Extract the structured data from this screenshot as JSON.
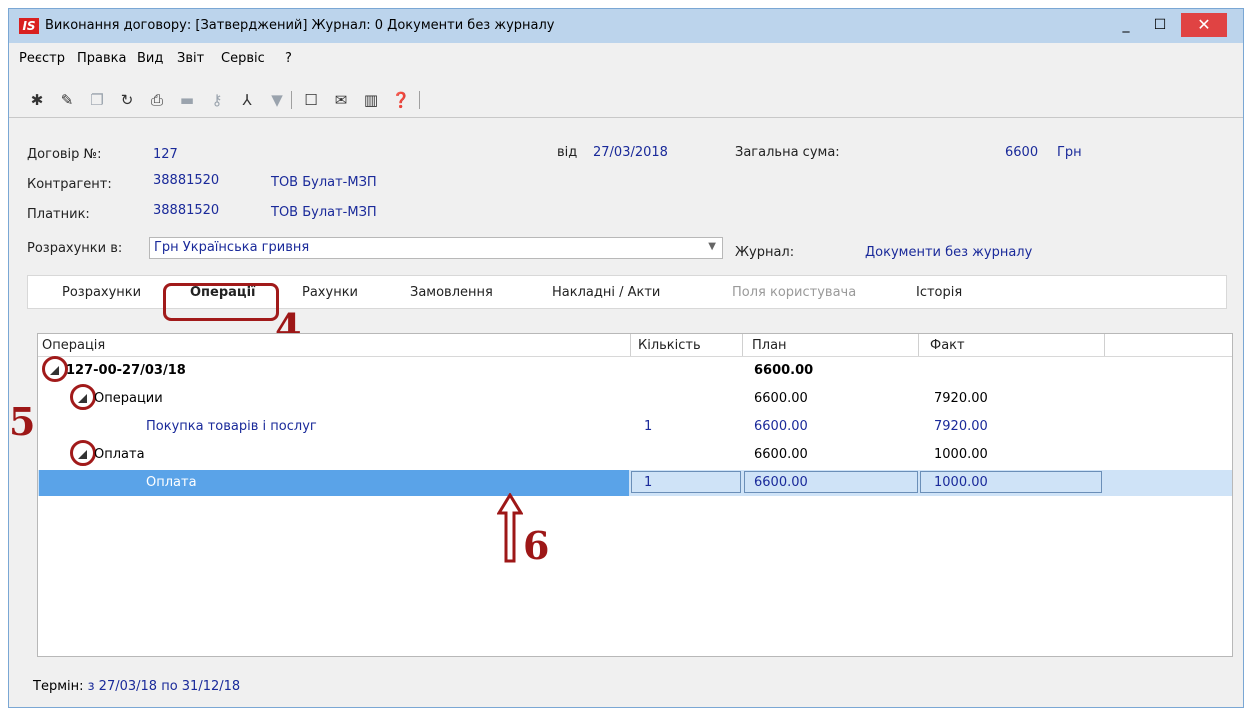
{
  "window": {
    "title": "Виконання договору: [Затверджений] Журнал: 0 Документи без журналу",
    "logo_text": "IS",
    "controls": {
      "minimize": "_",
      "maximize": "☐",
      "close": "✕"
    }
  },
  "menu": [
    "Реєстр",
    "Правка",
    "Вид",
    "Звіт",
    "Сервіс",
    "?"
  ],
  "toolbar": {
    "icons": [
      {
        "name": "new-doc-icon",
        "glyph": "✱",
        "dim": false
      },
      {
        "name": "edit-doc-icon",
        "glyph": "✎",
        "dim": false
      },
      {
        "name": "copy-doc-icon",
        "glyph": "❐",
        "dim": true
      },
      {
        "name": "refresh-icon",
        "glyph": "↻",
        "dim": false
      },
      {
        "name": "print-icon",
        "glyph": "⎙",
        "dim": false
      },
      {
        "name": "folder-icon",
        "glyph": "▬",
        "dim": true
      },
      {
        "name": "key-icon",
        "glyph": "⚷",
        "dim": true
      },
      {
        "name": "tree-icon",
        "glyph": "⅄",
        "dim": false
      },
      {
        "name": "filter-icon",
        "glyph": "▼",
        "dim": true
      },
      {
        "name": "window-icon",
        "glyph": "☐",
        "dim": false
      },
      {
        "name": "mail-icon",
        "glyph": "✉",
        "dim": false
      },
      {
        "name": "columns-icon",
        "glyph": "▥",
        "dim": false
      },
      {
        "name": "help-icon",
        "glyph": "❓",
        "dim": false
      }
    ]
  },
  "header": {
    "contract_label": "Договір  №:",
    "contract_no": "127",
    "date_label": "від",
    "date": "27/03/2018",
    "total_label": "Загальна сума:",
    "total_value": "6600",
    "total_currency": "Грн",
    "counterparty_label": "Контрагент:",
    "counterparty_code": "38881520",
    "counterparty_name": "ТОВ Булат-МЗП",
    "payer_label": "Платник:",
    "payer_code": "38881520",
    "payer_name": "ТОВ Булат-МЗП",
    "settlement_label": "Розрахунки в:",
    "settlement_value": "Грн Українська гривня",
    "journal_label": "Журнал:",
    "journal_value": "Документи без журналу"
  },
  "tabs": [
    {
      "label": "Розрахунки",
      "active": false,
      "disabled": false
    },
    {
      "label": "Операції",
      "active": true,
      "disabled": false
    },
    {
      "label": "Рахунки",
      "active": false,
      "disabled": false
    },
    {
      "label": "Замовлення",
      "active": false,
      "disabled": false
    },
    {
      "label": "Накладні / Акти",
      "active": false,
      "disabled": false
    },
    {
      "label": "Поля користувача",
      "active": false,
      "disabled": true
    },
    {
      "label": "Історія",
      "active": false,
      "disabled": false
    }
  ],
  "grid": {
    "columns": [
      "Операція",
      "Кількість",
      "План",
      "Факт"
    ],
    "rows": [
      {
        "level": 0,
        "expander": true,
        "name": "127-00-27/03/18",
        "qty": "",
        "plan": "6600.00",
        "fact": "",
        "bold": true,
        "blue": false,
        "selected": false
      },
      {
        "level": 1,
        "expander": true,
        "name": "Операции",
        "qty": "",
        "plan": "6600.00",
        "fact": "7920.00",
        "bold": false,
        "blue": false,
        "selected": false
      },
      {
        "level": 2,
        "expander": false,
        "name": "Покупка товарів і послуг",
        "qty": "1",
        "plan": "6600.00",
        "fact": "7920.00",
        "bold": false,
        "blue": true,
        "selected": false
      },
      {
        "level": 1,
        "expander": true,
        "name": "Оплата",
        "qty": "",
        "plan": "6600.00",
        "fact": "1000.00",
        "bold": false,
        "blue": false,
        "selected": false
      },
      {
        "level": 2,
        "expander": false,
        "name": "Оплата",
        "qty": "1",
        "plan": "6600.00",
        "fact": "1000.00",
        "bold": false,
        "blue": true,
        "selected": true
      }
    ]
  },
  "annotations": {
    "a4": "4",
    "a5": "5",
    "a6": "6"
  },
  "footer": {
    "label": "Термін:",
    "value": "з 27/03/18 по 31/12/18"
  },
  "colors": {
    "annotation": "#9d1717",
    "selection": "#5aa3e8",
    "value_text": "#1a2a9a"
  }
}
